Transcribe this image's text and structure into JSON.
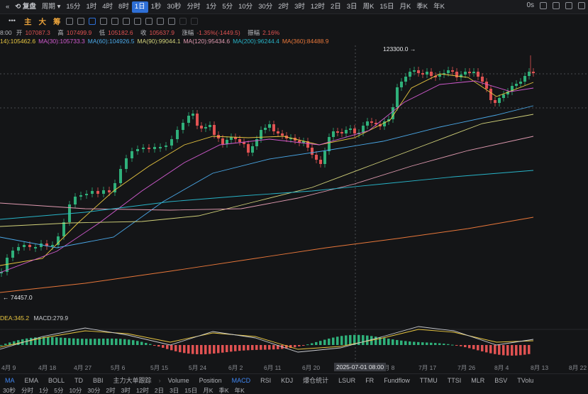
{
  "topbar": {
    "replay_label": "复盘",
    "period_label": "周期",
    "timeframes": [
      "15分",
      "1时",
      "4时",
      "8时",
      "1日",
      "1秒",
      "30秒",
      "分时",
      "1分",
      "5分",
      "10分",
      "30分",
      "2时",
      "3时",
      "12时",
      "2日",
      "3日",
      "周K",
      "15日",
      "月K",
      "季K",
      "年K"
    ],
    "active_timeframe": "1日",
    "right_value": "0s"
  },
  "toolbar2": {
    "chars": [
      "主",
      "大",
      "筹"
    ]
  },
  "ohlc": {
    "time": "8:00",
    "open_label": "开",
    "open": "107087.3",
    "high_label": "高",
    "high": "107499.9",
    "low_label": "低",
    "low": "105182.6",
    "close_label": "收",
    "close": "105637.9",
    "change_label": "涨幅",
    "change": "-1.35%(-1449.5)",
    "amp_label": "振幅",
    "amp": "2.16%"
  },
  "ma": [
    {
      "label": "14):105462.6",
      "color": "#e8c640"
    },
    {
      "label": "MA(30):105733.3",
      "color": "#d25bd0"
    },
    {
      "label": "MA(60):104926.5",
      "color": "#4aa8e8"
    },
    {
      "label": "MA(90):99044.1",
      "color": "#d2d27a"
    },
    {
      "label": "MA(120):95434.6",
      "color": "#e09ab0"
    },
    {
      "label": "MA(200):96244.4",
      "color": "#28b4c8"
    },
    {
      "label": "MA(360):84488.9",
      "color": "#e8773a"
    }
  ],
  "price_labels": {
    "high": "123300.0",
    "low": "74457.0"
  },
  "macd": {
    "dea": "DEA:345.2",
    "macd": "MACD:279.9"
  },
  "colors": {
    "up": "#2fb07a",
    "down": "#e05252"
  },
  "xaxis": [
    {
      "label": "4月 9"
    },
    {
      "label": "4月 18"
    },
    {
      "label": "4月 27"
    },
    {
      "label": "5月 6"
    },
    {
      "label": "5月 15"
    },
    {
      "label": "5月 24"
    },
    {
      "label": "6月 2"
    },
    {
      "label": "6月 11"
    },
    {
      "label": "6月 20"
    },
    {
      "label": "7月 8"
    },
    {
      "label": "7月 17"
    },
    {
      "label": "7月 26"
    },
    {
      "label": "8月 4"
    },
    {
      "label": "8月 13"
    },
    {
      "label": "8月 22"
    }
  ],
  "crosshair_time": "2025-07-01 08:00",
  "indicator_tabs": [
    "MA",
    "EMA",
    "BOLL",
    "TD",
    "BBI",
    "主力大单跟踪",
    "›",
    "Volume",
    "Position",
    "MACD",
    "RSI",
    "KDJ",
    "爆仓统计",
    "LSUR",
    "FR",
    "Fundflow",
    "TTMU",
    "TTSI",
    "MLR",
    "BSV",
    "TVolu"
  ],
  "active_indicator_main": "MA",
  "active_indicator_sub": "MACD",
  "bottom_strip": [
    "30秒",
    "分时",
    "1分",
    "5分",
    "10分",
    "30分",
    "2时",
    "3时",
    "12时",
    "2日",
    "3日",
    "15日",
    "月K",
    "季K",
    "年K"
  ]
}
